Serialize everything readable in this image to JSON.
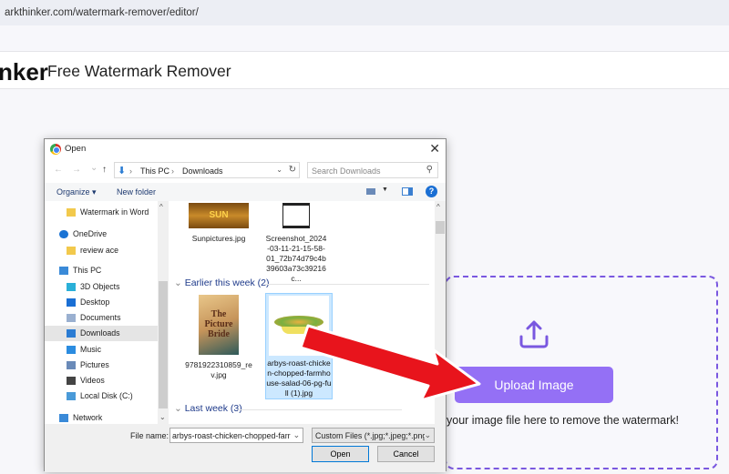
{
  "browser": {
    "url": "arkthinker.com/watermark-remover/editor/"
  },
  "site": {
    "logo_fragment": "nker",
    "title": "Free Watermark Remover"
  },
  "upload": {
    "button_label": "Upload Image",
    "drop_text": "your image file here to remove the watermark!",
    "accent": "#9470f5",
    "border_color": "#7a58e0"
  },
  "dialog": {
    "title": "Open",
    "nav": {
      "back": "←",
      "forward": "→",
      "recent": "⌄",
      "up": "↑"
    },
    "breadcrumb": [
      "This PC",
      "Downloads"
    ],
    "search_placeholder": "Search Downloads",
    "toolbar": {
      "organize": "Organize ▾",
      "new_folder": "New folder"
    },
    "sidebar": [
      {
        "label": "Watermark in Word",
        "icon": "folder-icon"
      },
      {
        "label": "OneDrive",
        "icon": "cloud-icon"
      },
      {
        "label": "review ace",
        "icon": "folder-icon"
      },
      {
        "label": "This PC",
        "icon": "computer-icon"
      },
      {
        "label": "3D Objects",
        "icon": "cube-icon"
      },
      {
        "label": "Desktop",
        "icon": "desktop-icon"
      },
      {
        "label": "Documents",
        "icon": "document-icon"
      },
      {
        "label": "Downloads",
        "icon": "download-icon",
        "selected": true
      },
      {
        "label": "Music",
        "icon": "music-icon"
      },
      {
        "label": "Pictures",
        "icon": "pictures-icon"
      },
      {
        "label": "Videos",
        "icon": "videos-icon"
      },
      {
        "label": "Local Disk (C:)",
        "icon": "disk-icon"
      },
      {
        "label": "Network",
        "icon": "network-icon"
      }
    ],
    "files_top": [
      {
        "name": "Sunpictures.jpg"
      },
      {
        "name": "Screenshot_2024-03-11-21-15-58-01_72b74d79c4b39603a73c39216c..."
      }
    ],
    "groups": [
      {
        "label": "Earlier this week (2)",
        "files": [
          {
            "name": "9781922310859_rev.jpg"
          },
          {
            "name": "arbys-roast-chicken-chopped-farmhouse-salad-06-pg-full (1).jpg",
            "selected": true
          }
        ]
      },
      {
        "label": "Last week (3)",
        "files": []
      }
    ],
    "filename_label": "File name:",
    "filename_value": "arbys-roast-chicken-chopped-farr",
    "filetype_value": "Custom Files (*.jpg;*.jpeg;*.png",
    "open_label": "Open",
    "cancel_label": "Cancel"
  }
}
